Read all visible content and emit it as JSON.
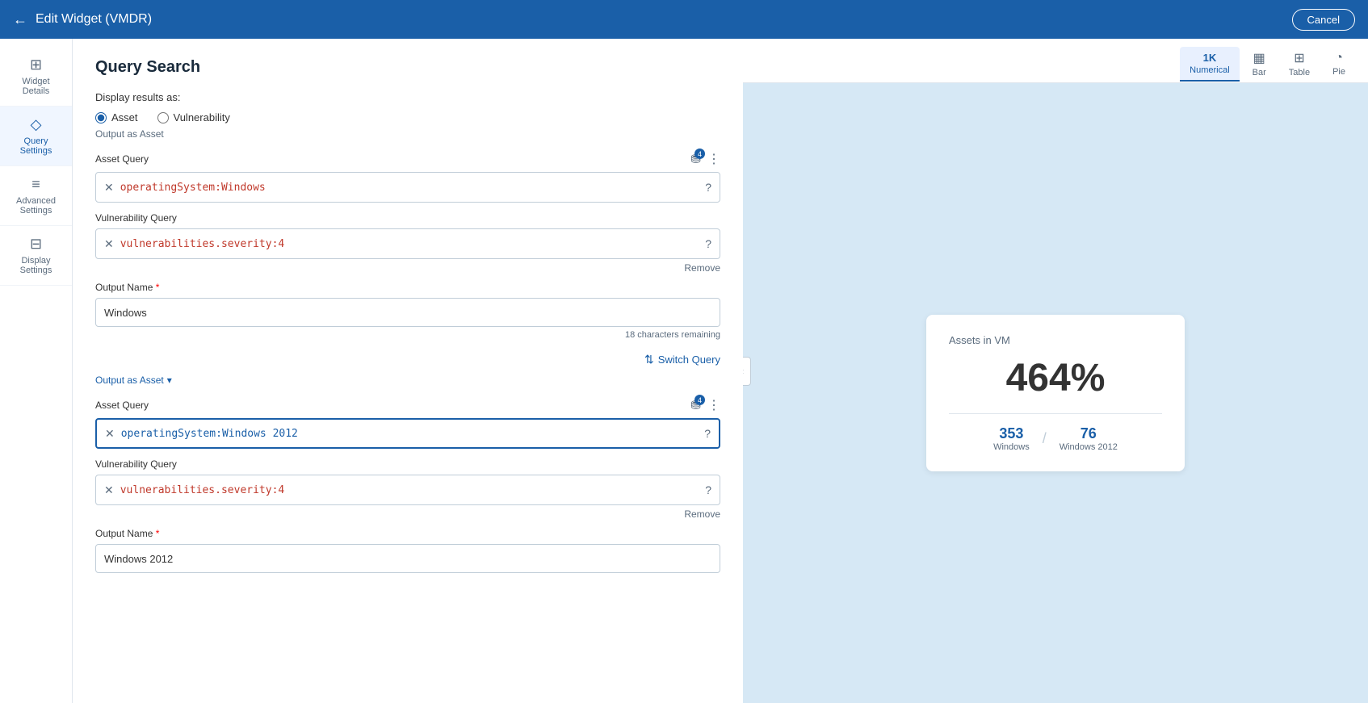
{
  "header": {
    "title": "Edit Widget (VMDR)",
    "cancel_label": "Cancel"
  },
  "sidebar": {
    "items": [
      {
        "id": "widget-details",
        "icon": "⊞",
        "label": "Widget\nDetails"
      },
      {
        "id": "query-settings",
        "icon": "◇",
        "label": "Query\nSettings",
        "active": true
      },
      {
        "id": "advanced-settings",
        "icon": "≡",
        "label": "Advanced\nSettings"
      },
      {
        "id": "display-settings",
        "icon": "⊟",
        "label": "Display\nSettings"
      }
    ]
  },
  "main": {
    "title": "Query Search",
    "display_results_label": "Display results as:",
    "radio_options": [
      {
        "id": "asset",
        "label": "Asset",
        "checked": true
      },
      {
        "id": "vulnerability",
        "label": "Vulnerability",
        "checked": false
      }
    ],
    "output_as_asset_label": "Output as Asset",
    "first_query_block": {
      "asset_query_label": "Asset Query",
      "filter_badge_count": "4",
      "asset_query_value": "operatingSystem:Windows",
      "asset_query_color": "red",
      "vulnerability_query_label": "Vulnerability Query",
      "vulnerability_query_value": "vulnerabilities.severity:4",
      "vulnerability_query_color": "red",
      "remove_label": "Remove",
      "output_name_label": "Output Name",
      "required_star": "*",
      "output_name_value": "Windows",
      "chars_remaining": "18 characters remaining"
    },
    "switch_query_label": "Switch Query",
    "second_query_block": {
      "output_as_dropdown_label": "Output as Asset",
      "dropdown_arrow": "▾",
      "asset_query_label": "Asset Query",
      "filter_badge_count": "4",
      "asset_query_value": "operatingSystem:Windows 2012",
      "asset_query_active": true,
      "vulnerability_query_label": "Vulnerability Query",
      "vulnerability_query_value": "vulnerabilities.severity:4",
      "remove_label": "Remove",
      "output_name_label": "Output Name",
      "required_star": "*",
      "output_name_value": "Windows 2012"
    }
  },
  "chart_tabs": [
    {
      "id": "numerical",
      "icon": "1K",
      "label": "Numerical",
      "active": true
    },
    {
      "id": "bar",
      "icon": "▦",
      "label": "Bar",
      "active": false
    },
    {
      "id": "table",
      "icon": "⊞",
      "label": "Table",
      "active": false
    },
    {
      "id": "pie",
      "icon": "◔",
      "label": "Pie",
      "active": false
    }
  ],
  "widget_preview": {
    "title": "Assets in VM",
    "big_number": "464%",
    "stat1_num": "353",
    "stat1_label": "Windows",
    "stat2_num": "76",
    "stat2_label": "Windows 2012"
  }
}
